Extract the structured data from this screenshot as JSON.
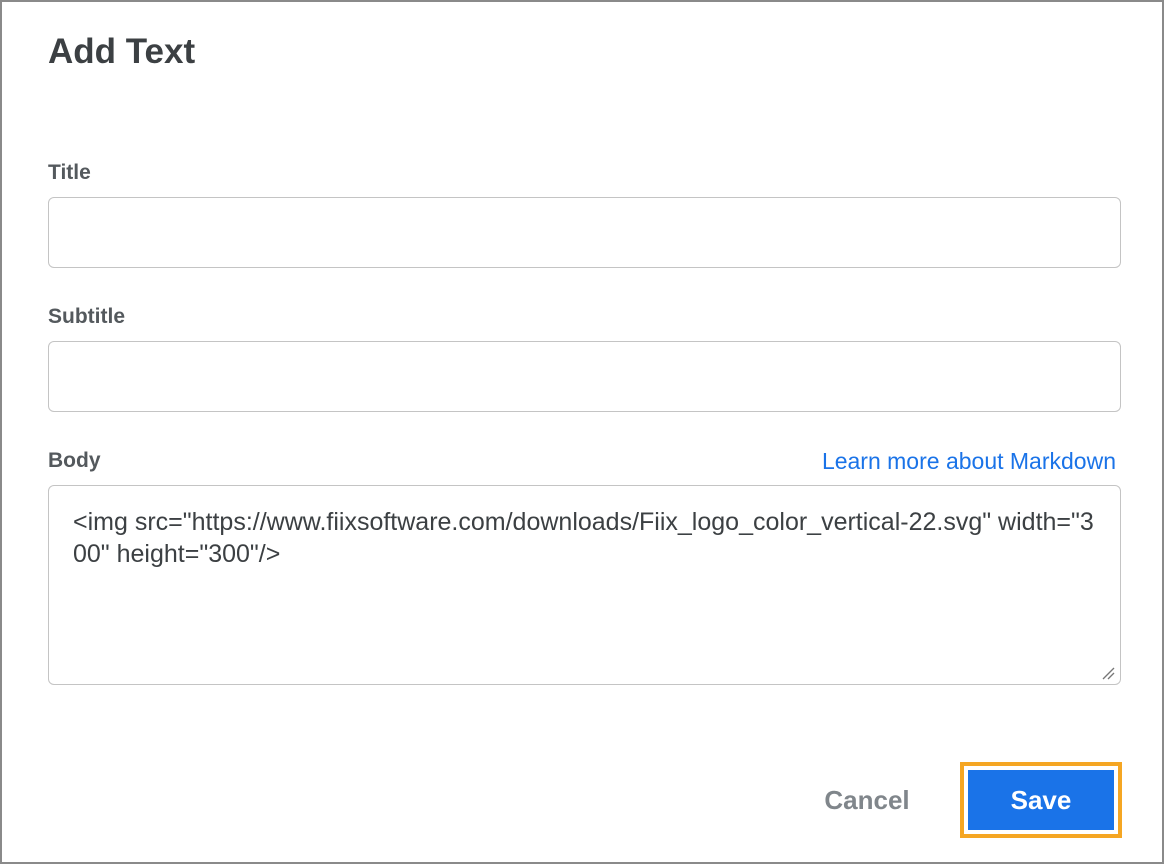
{
  "dialog": {
    "title": "Add Text"
  },
  "fields": {
    "title": {
      "label": "Title",
      "value": ""
    },
    "subtitle": {
      "label": "Subtitle",
      "value": ""
    },
    "body": {
      "label": "Body",
      "value": "<img src=\"https://www.fiixsoftware.com/downloads/Fiix_logo_color_vertical-22.svg\" width=\"300\" height=\"300\"/>",
      "help_link": "Learn more about Markdown"
    }
  },
  "actions": {
    "cancel_label": "Cancel",
    "save_label": "Save"
  },
  "colors": {
    "accent": "#1a73e8",
    "focus_ring": "#f5a623"
  },
  "icons": {
    "resize": "resize-grip-icon"
  }
}
